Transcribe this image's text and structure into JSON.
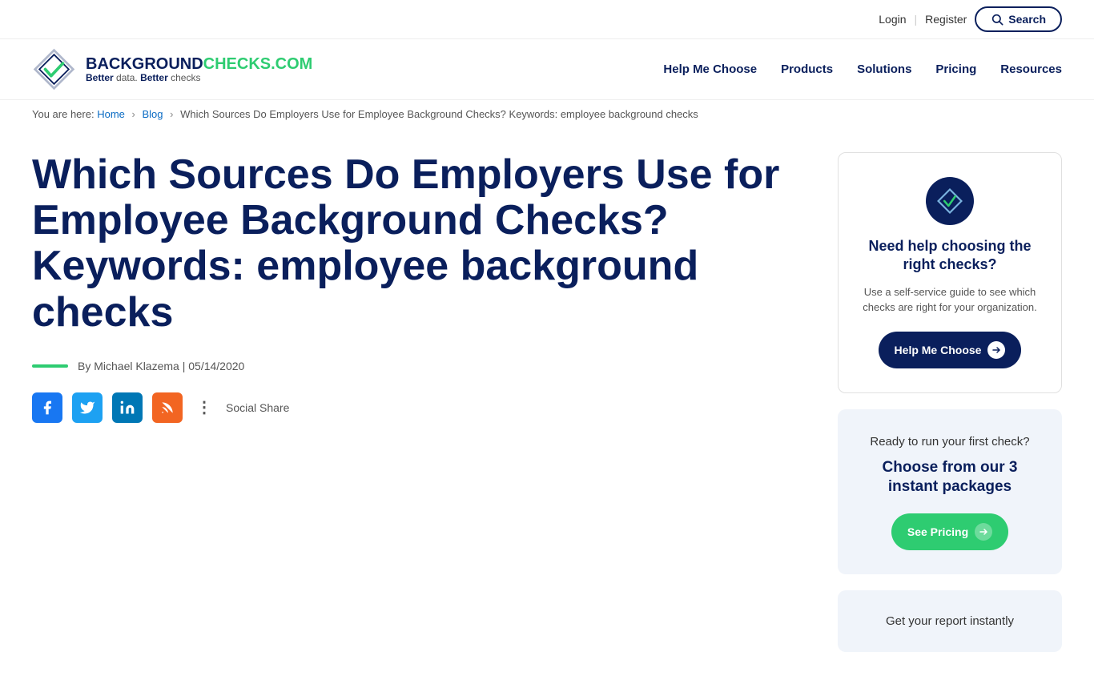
{
  "topbar": {
    "login_label": "Login",
    "register_label": "Register",
    "search_label": "Search"
  },
  "header": {
    "logo_brand_part1": "BACKGROUND",
    "logo_brand_part2": "CHECKS.COM",
    "logo_tagline_part1": "Better",
    "logo_tagline_word1": "data.",
    "logo_tagline_part2": "Better",
    "logo_tagline_word2": "checks",
    "nav": {
      "help_me_choose": "Help Me Choose",
      "products": "Products",
      "solutions": "Solutions",
      "pricing": "Pricing",
      "resources": "Resources"
    }
  },
  "breadcrumb": {
    "prefix": "You are here:",
    "home": "Home",
    "blog": "Blog",
    "current": "Which Sources Do Employers Use for Employee Background Checks? Keywords: employee background checks"
  },
  "article": {
    "title": "Which Sources Do Employers Use for Employee Background Checks? Keywords: employee background checks",
    "author": "By Michael Klazema | 05/14/2020",
    "social_share_label": "Social Share"
  },
  "sidebar": {
    "card1": {
      "heading": "Need help choosing the right checks?",
      "desc": "Use a self-service guide to see which checks are right for your organization.",
      "btn_label": "Help Me Choose"
    },
    "card2": {
      "heading_light": "Ready to run your first check?",
      "heading_bold": "Choose from our 3 instant packages",
      "btn_label": "See Pricing"
    },
    "card3": {
      "text": "Get your report instantly"
    }
  }
}
